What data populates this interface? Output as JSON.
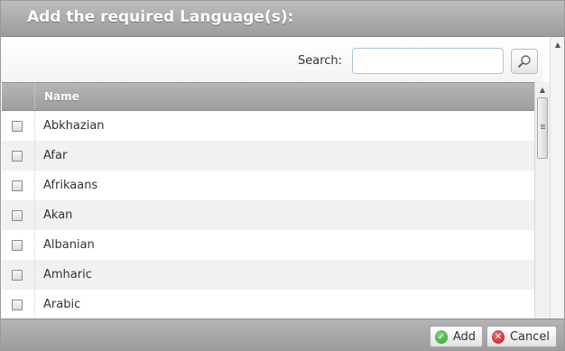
{
  "dialog": {
    "title": "Add the required Language(s):"
  },
  "search": {
    "label": "Search:",
    "value": "",
    "placeholder": ""
  },
  "table": {
    "header": {
      "name": "Name"
    },
    "rows": [
      {
        "name": "Abkhazian",
        "checked": false
      },
      {
        "name": "Afar",
        "checked": false
      },
      {
        "name": "Afrikaans",
        "checked": false
      },
      {
        "name": "Akan",
        "checked": false
      },
      {
        "name": "Albanian",
        "checked": false
      },
      {
        "name": "Amharic",
        "checked": false
      },
      {
        "name": "Arabic",
        "checked": false
      }
    ]
  },
  "footer": {
    "add_label": "Add",
    "cancel_label": "Cancel"
  },
  "icons": {
    "search": "magnifier-icon",
    "add": "check-circle-icon",
    "cancel": "close-circle-icon"
  },
  "colors": {
    "title_bar": "#a8a8a8",
    "footer_bar": "#a9a9a9",
    "row_alt": "#f1f1f1",
    "add_icon": "#2e9a2e",
    "cancel_icon": "#b51f1f"
  }
}
